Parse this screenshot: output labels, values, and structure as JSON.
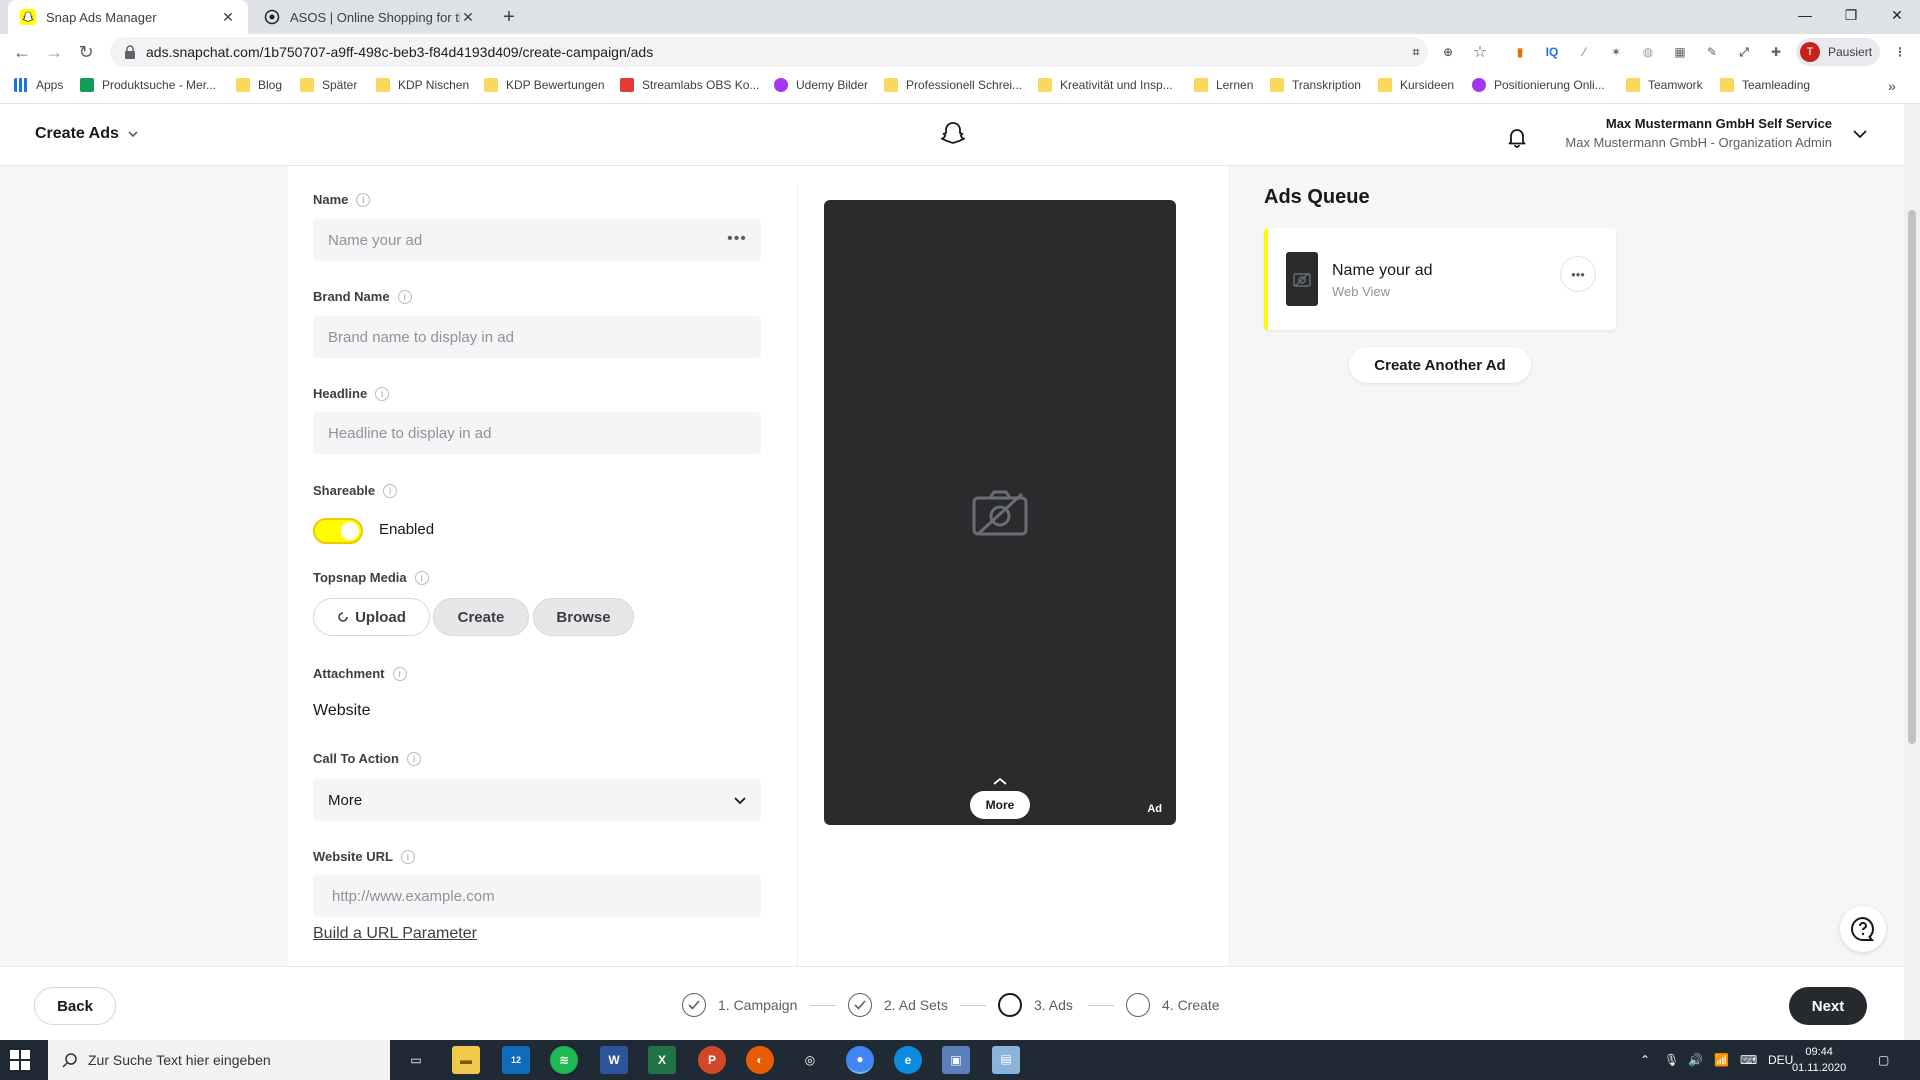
{
  "browser": {
    "tabs": [
      {
        "title": "Snap Ads Manager",
        "active": true
      },
      {
        "title": "ASOS | Online Shopping for the L",
        "active": false
      }
    ],
    "url": "ads.snapchat.com/1b750707-a9ff-498c-beb3-f84d4193d409/create-campaign/ads",
    "profile_label": "Pausiert",
    "profile_initial": "T",
    "bookmarks": [
      "Apps",
      "Produktsuche - Mer...",
      "Blog",
      "Später",
      "KDP Nischen",
      "KDP Bewertungen",
      "Streamlabs OBS Ko...",
      "Udemy Bilder",
      "Professionell Schrei...",
      "Kreativität und Insp...",
      "Lernen",
      "Transkription",
      "Kursideen",
      "Positionierung Onli...",
      "Teamwork",
      "Teamleading"
    ]
  },
  "header": {
    "title": "Create Ads",
    "account_name": "Max Mustermann GmbH Self Service",
    "account_org": "Max Mustermann GmbH - Organization Admin"
  },
  "form": {
    "name": {
      "label": "Name",
      "placeholder": "Name your ad"
    },
    "brand": {
      "label": "Brand Name",
      "placeholder": "Brand name to display in ad"
    },
    "headline": {
      "label": "Headline",
      "placeholder": "Headline to display in ad"
    },
    "shareable": {
      "label": "Shareable",
      "state": "Enabled"
    },
    "topsnap": {
      "label": "Topsnap Media",
      "upload": "Upload",
      "create": "Create",
      "browse": "Browse"
    },
    "attachment": {
      "label": "Attachment",
      "value": "Website"
    },
    "cta": {
      "label": "Call To Action",
      "value": "More"
    },
    "website": {
      "label": "Website URL",
      "placeholder": "http://www.example.com"
    },
    "url_param_link": "Build a URL Parameter"
  },
  "preview": {
    "more_label": "More",
    "ad_tag": "Ad"
  },
  "queue": {
    "title": "Ads Queue",
    "item_name": "Name your ad",
    "item_sub": "Web View",
    "another_button": "Create Another Ad"
  },
  "footer": {
    "back": "Back",
    "next": "Next",
    "steps": [
      "1. Campaign",
      "2. Ad Sets",
      "3. Ads",
      "4. Create"
    ]
  },
  "taskbar": {
    "search_placeholder": "Zur Suche Text hier eingeben",
    "mail_badge": "12",
    "lang": "DEU",
    "time": "09:44",
    "date": "01.11.2020"
  },
  "colors": {
    "accent": "#fffc00",
    "dark": "#262a2e"
  }
}
